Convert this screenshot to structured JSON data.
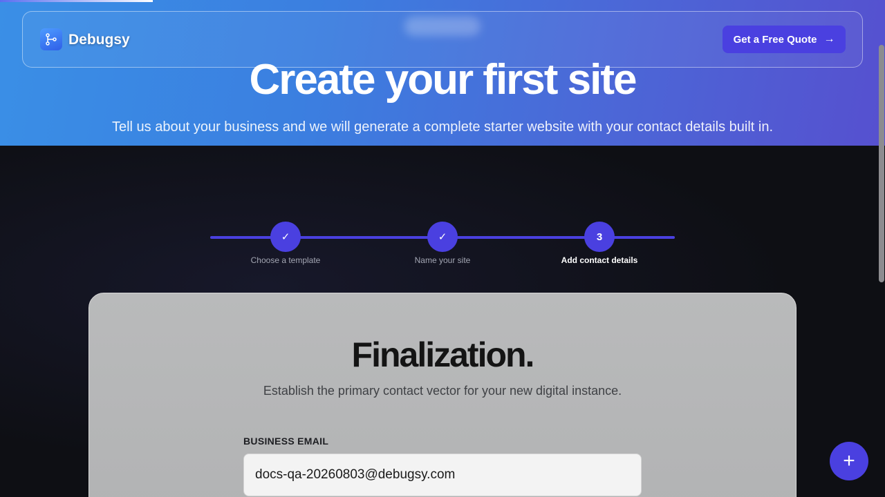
{
  "brand": {
    "name": "Debugsy",
    "logo_icon": "git-branch-icon"
  },
  "navbar": {
    "cta_label": "Get a Free Quote",
    "cta_icon": "arrow-right-icon"
  },
  "hero": {
    "title": "Create your first site",
    "subtitle": "Tell us about your business and we will generate a complete starter website with your contact details built in."
  },
  "stepper": {
    "steps": [
      {
        "label": "Choose a template",
        "marker": "✓",
        "state": "completed"
      },
      {
        "label": "Name your site",
        "marker": "✓",
        "state": "completed"
      },
      {
        "label": "Add contact details",
        "marker": "3",
        "state": "active"
      }
    ]
  },
  "form": {
    "title": "Finalization.",
    "subtitle": "Establish the primary contact vector for your new digital instance.",
    "email_label": "BUSINESS EMAIL",
    "email_value": "docs-qa-20260803@debugsy.com"
  },
  "fab": {
    "icon": "plus-icon",
    "glyph": "+"
  },
  "colors": {
    "accent": "#4a40e0",
    "hero_start": "#3a8fe6",
    "hero_end": "#5650cf",
    "dark_bg": "#0e0f14"
  }
}
